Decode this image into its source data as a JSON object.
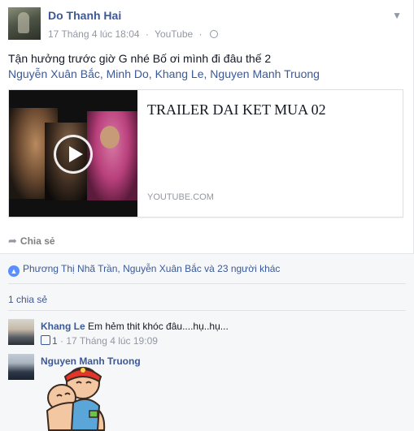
{
  "post": {
    "author": "Do Thanh Hai",
    "timestamp": "17 Tháng 4 lúc 18:04",
    "source": "YouTube",
    "separator": "·",
    "menu_icon": "chevron-down-icon",
    "privacy_icon": "globe-icon",
    "text": "Tận hưởng trước giờ G nhé Bố ơi mình đi đâu thế 2",
    "tags": [
      "Nguyễn Xuân Bắc",
      "Minh Do",
      "Khang Le",
      "Nguyen Manh Truong"
    ],
    "tag_separator": ", "
  },
  "link_card": {
    "title": "TRAILER DAI KET MUA 02",
    "domain": "YOUTUBE.COM",
    "play_icon": "play-icon"
  },
  "actions": {
    "share_label": "Chia sẻ",
    "share_icon": "share-arrow-icon"
  },
  "feedback": {
    "likes_text": "Phương Thị Nhã Trần, Nguyễn Xuân Bắc và 23 người khác",
    "like_icon": "like-icon",
    "shares_text": "1 chia sẻ"
  },
  "comments": [
    {
      "name": "Khang Le",
      "text": "Em hẻm thit khóc đâu....hụ..hụ...",
      "like_count": "1",
      "timestamp": "17 Tháng 4 lúc 19:09"
    },
    {
      "name": "Nguyen Manh Truong",
      "text": "",
      "sticker": "hugging-sticker"
    }
  ],
  "colors": {
    "link": "#3b5998",
    "meta": "#9197a3",
    "feedback_bg": "#f6f7f9"
  }
}
